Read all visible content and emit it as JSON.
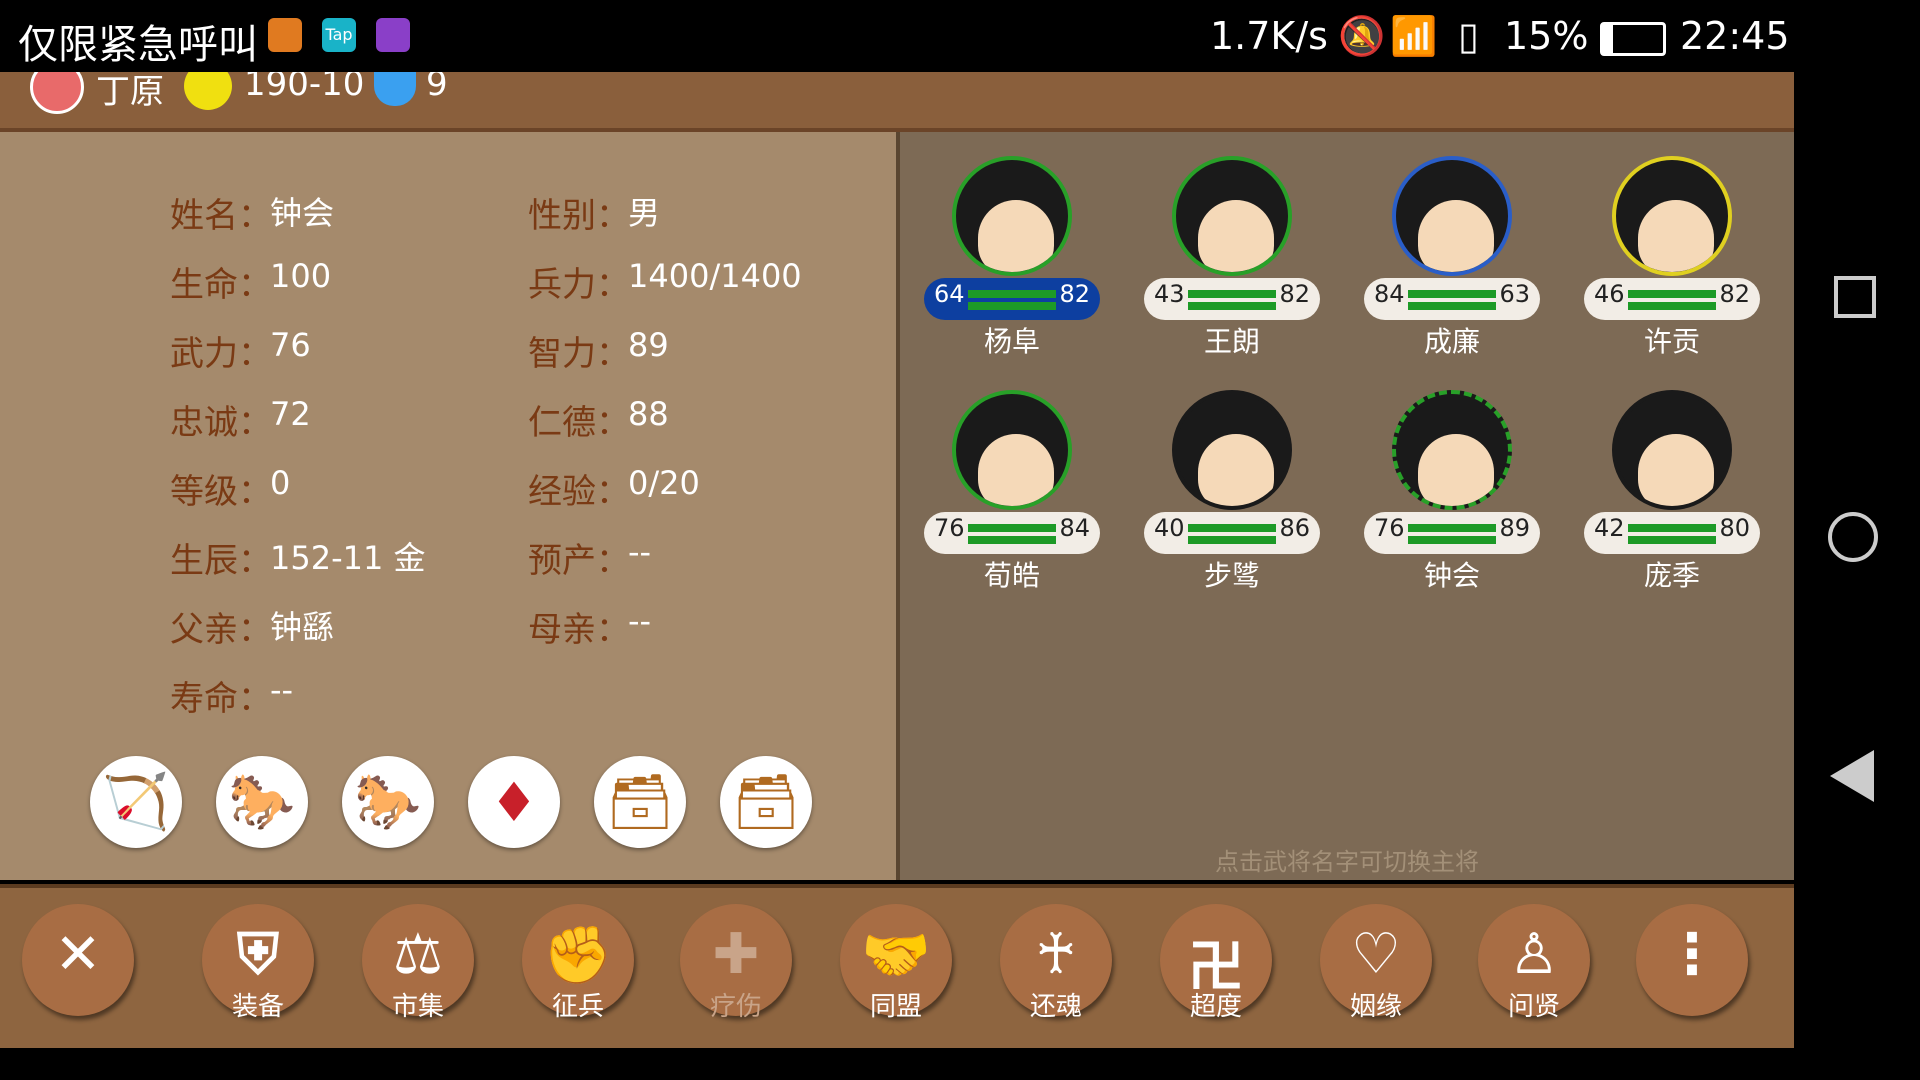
{
  "status_bar": {
    "carrier": "仅限紧急呼叫",
    "speed": "1.7K/s",
    "battery": "15%",
    "time": "22:45"
  },
  "top_bar": {
    "city": "丁原",
    "date": "190-10",
    "count": "9"
  },
  "general": {
    "rows": [
      {
        "l1": "姓名：",
        "v1": "钟会",
        "l2": "性别：",
        "v2": "男"
      },
      {
        "l1": "生命：",
        "v1": "100",
        "l2": "兵力：",
        "v2": "1400/1400"
      },
      {
        "l1": "武力：",
        "v1": "76",
        "l2": "智力：",
        "v2": "89"
      },
      {
        "l1": "忠诚：",
        "v1": "72",
        "l2": "仁德：",
        "v2": "88"
      },
      {
        "l1": "等级：",
        "v1": "0",
        "l2": "经验：",
        "v2": "0/20"
      },
      {
        "l1": "生辰：",
        "v1": "152-11 金",
        "l2": "预产：",
        "v2": "--"
      },
      {
        "l1": "父亲：",
        "v1": "钟繇",
        "l2": "母亲：",
        "v2": "--"
      },
      {
        "l1": "寿命：",
        "v1": "--",
        "l2": "",
        "v2": ""
      }
    ],
    "equipment": [
      "bow-icon",
      "horse-icon",
      "horse-icon",
      "ruby-icon",
      "treasure-box-icon",
      "treasure-box-icon"
    ]
  },
  "generals": [
    {
      "name": "杨阜",
      "left": "64",
      "right": "82",
      "selected": true
    },
    {
      "name": "王朗",
      "left": "43",
      "right": "82"
    },
    {
      "name": "成廉",
      "left": "84",
      "right": "63"
    },
    {
      "name": "许贡",
      "left": "46",
      "right": "82"
    },
    {
      "name": "荀皓",
      "left": "76",
      "right": "84"
    },
    {
      "name": "步骘",
      "left": "40",
      "right": "86"
    },
    {
      "name": "钟会",
      "left": "76",
      "right": "89"
    },
    {
      "name": "庞季",
      "left": "42",
      "right": "80"
    }
  ],
  "hint": "点击武将名字可切换主将",
  "actions": [
    {
      "label": "",
      "icon": "close-icon",
      "glyph": "✕"
    },
    {
      "label": "装备",
      "icon": "armor-icon",
      "glyph": "⛨"
    },
    {
      "label": "市集",
      "icon": "scale-icon",
      "glyph": "⚖"
    },
    {
      "label": "征兵",
      "icon": "fist-icon",
      "glyph": "✊"
    },
    {
      "label": "疗伤",
      "icon": "heal-icon",
      "glyph": "✚",
      "disabled": true
    },
    {
      "label": "同盟",
      "icon": "handshake-icon",
      "glyph": "🤝"
    },
    {
      "label": "还魂",
      "icon": "revive-icon",
      "glyph": "♰"
    },
    {
      "label": "超度",
      "icon": "ritual-icon",
      "glyph": "卍"
    },
    {
      "label": "姻缘",
      "icon": "heart-question-icon",
      "glyph": "♡"
    },
    {
      "label": "问贤",
      "icon": "sage-icon",
      "glyph": "♙"
    },
    {
      "label": "",
      "icon": "more-icon",
      "glyph": "⋮"
    }
  ]
}
